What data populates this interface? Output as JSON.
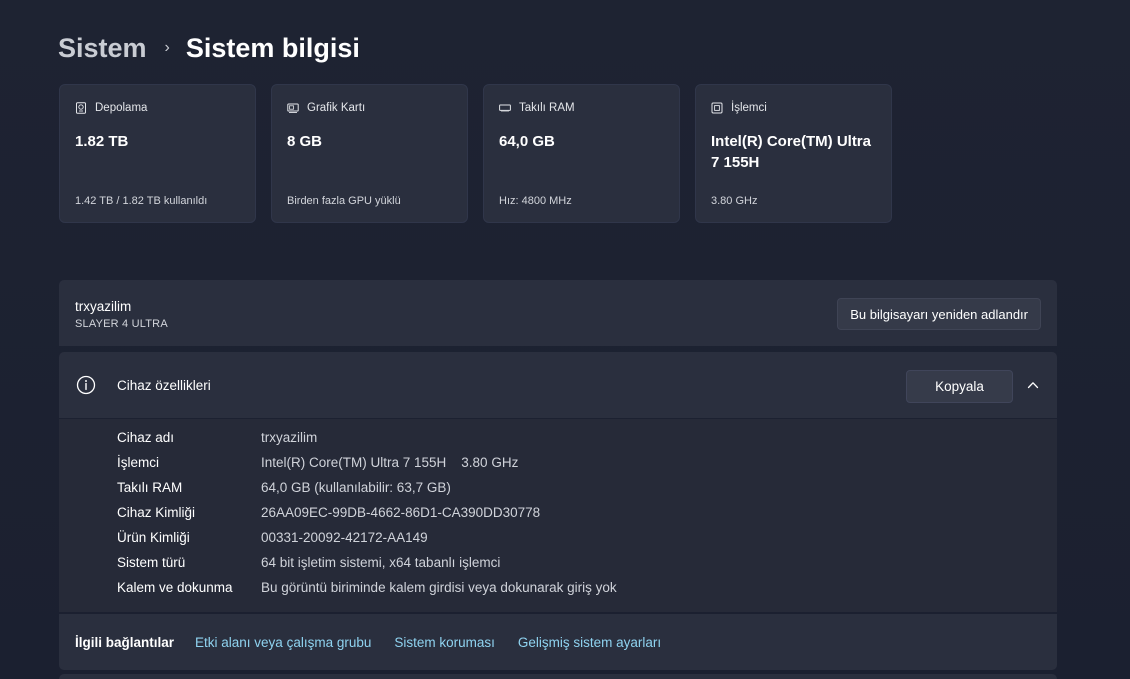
{
  "breadcrumb": {
    "parent": "Sistem",
    "separator": "›",
    "current": "Sistem bilgisi"
  },
  "cards": [
    {
      "icon": "storage-icon",
      "title": "Depolama",
      "value": "1.82 TB",
      "sub": "1.42 TB / 1.82 TB kullanıldı"
    },
    {
      "icon": "gpu-icon",
      "title": "Grafik Kartı",
      "value": "8 GB",
      "sub": "Birden fazla GPU yüklü"
    },
    {
      "icon": "ram-icon",
      "title": "Takılı RAM",
      "value": "64,0 GB",
      "sub": "Hız: 4800 MHz"
    },
    {
      "icon": "cpu-icon",
      "title": "İşlemci",
      "value": "Intel(R) Core(TM) Ultra 7 155H",
      "sub": "3.80 GHz"
    }
  ],
  "device": {
    "name": "trxyazilim",
    "model": "SLAYER 4 ULTRA",
    "rename_label": "Bu bilgisayarı yeniden adlandır"
  },
  "specs": {
    "title": "Cihaz özellikleri",
    "copy_label": "Kopyala",
    "rows": [
      {
        "label": "Cihaz adı",
        "value": "trxyazilim"
      },
      {
        "label": "İşlemci",
        "value": "Intel(R) Core(TM) Ultra 7 155H    3.80 GHz"
      },
      {
        "label": "Takılı RAM",
        "value": "64,0 GB (kullanılabilir: 63,7 GB)"
      },
      {
        "label": "Cihaz Kimliği",
        "value": "26AA09EC-99DB-4662-86D1-CA390DD30778"
      },
      {
        "label": "Ürün Kimliği",
        "value": "00331-20092-42172-AA149"
      },
      {
        "label": "Sistem türü",
        "value": "64 bit işletim sistemi, x64 tabanlı işlemci"
      },
      {
        "label": "Kalem ve dokunma",
        "value": "Bu görüntü biriminde kalem girdisi veya dokunarak giriş yok"
      }
    ]
  },
  "related": {
    "title": "İlgili bağlantılar",
    "links": [
      "Etki alanı veya çalışma grubu",
      "Sistem koruması",
      "Gelişmiş sistem ayarları"
    ]
  },
  "colors": {
    "background": "#1d2231",
    "card": "#2a2f3e",
    "link": "#8fd3f0"
  }
}
